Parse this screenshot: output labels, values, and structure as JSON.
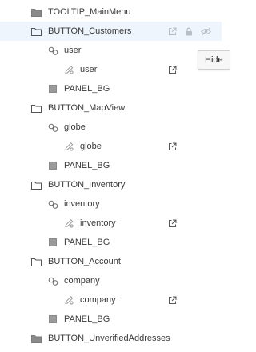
{
  "tree": {
    "rows": [
      {
        "id": "tooltip-mainmenu",
        "label": "TOOLTIP_MainMenu",
        "type": "folder-filled"
      },
      {
        "id": "button-customers",
        "label": "BUTTON_Customers",
        "type": "folder",
        "highlighted": true
      },
      {
        "id": "customers-user-group",
        "label": "user",
        "type": "group"
      },
      {
        "id": "customers-user-image",
        "label": "user",
        "type": "image"
      },
      {
        "id": "customers-panel-bg",
        "label": "PANEL_BG",
        "type": "panel"
      },
      {
        "id": "button-mapview",
        "label": "BUTTON_MapView",
        "type": "folder"
      },
      {
        "id": "mapview-globe-group",
        "label": "globe",
        "type": "group"
      },
      {
        "id": "mapview-globe-image",
        "label": "globe",
        "type": "image"
      },
      {
        "id": "mapview-panel-bg",
        "label": "PANEL_BG",
        "type": "panel"
      },
      {
        "id": "button-inventory",
        "label": "BUTTON_Inventory",
        "type": "folder"
      },
      {
        "id": "inventory-group",
        "label": "inventory",
        "type": "group"
      },
      {
        "id": "inventory-image",
        "label": "inventory",
        "type": "image"
      },
      {
        "id": "inventory-panel-bg",
        "label": "PANEL_BG",
        "type": "panel"
      },
      {
        "id": "button-account",
        "label": "BUTTON_Account",
        "type": "folder"
      },
      {
        "id": "account-company-group",
        "label": "company",
        "type": "group"
      },
      {
        "id": "account-company-image",
        "label": "company",
        "type": "image"
      },
      {
        "id": "account-panel-bg",
        "label": "PANEL_BG",
        "type": "panel"
      },
      {
        "id": "button-unverified",
        "label": "BUTTON_UnverifiedAddresses",
        "type": "folder-filled"
      }
    ]
  },
  "tooltip": {
    "text": "Hide"
  },
  "icons": {
    "folder": "folder-icon",
    "folder_filled": "folder-filled-icon",
    "group": "group-link-icon",
    "image": "image-symbol-icon",
    "panel": "panel-square-icon",
    "external": "external-link-icon",
    "lock": "lock-icon",
    "hide": "eye-hidden-icon"
  },
  "colors": {
    "highlight_row": "#eef5fc",
    "icon": "#6a6a6a",
    "action_icon": "#b8bec6"
  }
}
